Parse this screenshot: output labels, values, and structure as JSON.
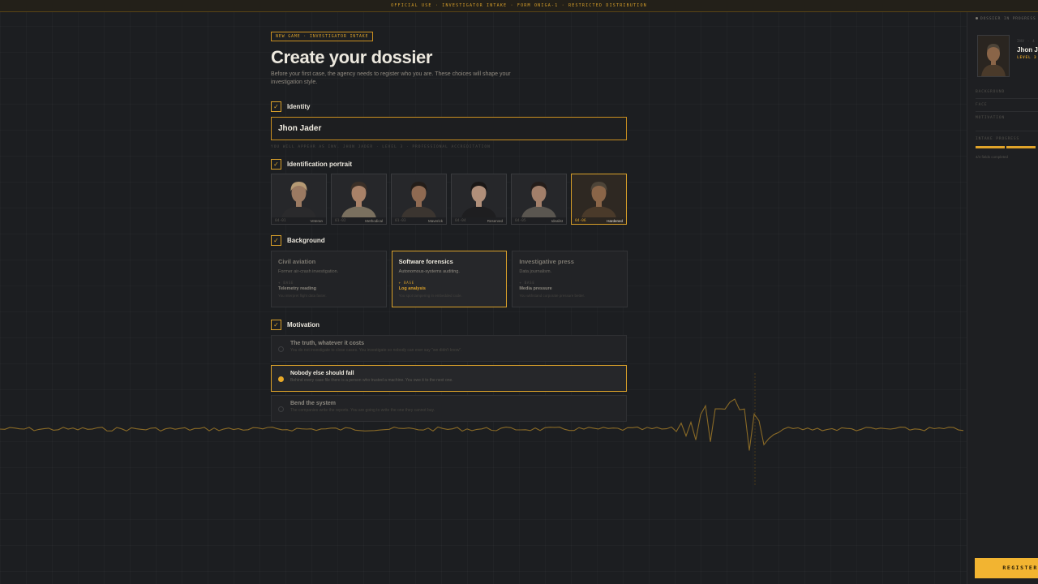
{
  "topbar": {
    "text": "OFFICIAL USE · INVESTIGATOR INTAKE · FORM ONIGA-1 · RESTRICTED DISTRIBUTION"
  },
  "header": {
    "tag": "NEW GAME · INVESTIGATOR INTAKE",
    "title": "Create your dossier",
    "subtitle": "Before your first case, the agency needs to register who you are. These choices will shape your investigation style."
  },
  "identity": {
    "title": "Identity",
    "check": "✓",
    "name_value": "Jhon Jader",
    "note": "YOU WILL APPEAR AS INV. JHON JADER · LEVEL 3 · PROFESSIONAL ACCREDITATION"
  },
  "portrait": {
    "title": "Identification portrait",
    "check": "✓",
    "items": [
      {
        "num": "04-01",
        "label": "Veteran",
        "skin": "#9b7a62",
        "hair": "#b59a74",
        "cloth": "#2a2a2c"
      },
      {
        "num": "01-02",
        "label": "Methodical",
        "skin": "#a88168",
        "hair": "#3a2f27",
        "cloth": "#7a705f"
      },
      {
        "num": "01-03",
        "label": "Maverick",
        "skin": "#8f6a52",
        "hair": "#231d19",
        "cloth": "#3b3530"
      },
      {
        "num": "04-04",
        "label": "Reserved",
        "skin": "#b08f7a",
        "hair": "#1a1716",
        "cloth": "#1e1e20"
      },
      {
        "num": "04-05",
        "label": "Idealist",
        "skin": "#a27f6a",
        "hair": "#241d1a",
        "cloth": "#5a5650"
      },
      {
        "num": "04-06",
        "label": "Hardened",
        "skin": "#8a6548",
        "hair": "#4d4438",
        "cloth": "#4a3a2a"
      }
    ]
  },
  "background": {
    "title": "Background",
    "check": "✓",
    "cards": [
      {
        "title": "Civil aviation",
        "sub": "Former air-crash investigation.",
        "bonus": "+ BASE",
        "skill": "Telemetry reading",
        "desc": "You interpret flight data faster."
      },
      {
        "title": "Software forensics",
        "sub": "Autonomous-systems auditing.",
        "bonus": "+ BASE",
        "skill": "Log analysis",
        "desc": "You spot tampering in embedded code."
      },
      {
        "title": "Investigative press",
        "sub": "Data journalism.",
        "bonus": "+ BASE",
        "skill": "Media pressure",
        "desc": "You withstand corporate pressure better."
      }
    ]
  },
  "motivation": {
    "title": "Motivation",
    "check": "✓",
    "options": [
      {
        "title": "The truth, whatever it costs",
        "desc": "You do not investigate to close cases. You investigate so nobody can ever say \"we didn't know\"."
      },
      {
        "title": "Nobody else should fall",
        "desc": "Behind every case file there is a person who trusted a machine. You owe it to the next one."
      },
      {
        "title": "Bend the system",
        "desc": "The companies write the reports. You are going to write the one they cannot buy."
      }
    ]
  },
  "sidebar": {
    "header": "DOSSIER IN PROGRESS",
    "code": "INV · 4",
    "name": "Jhon J",
    "level": "LEVEL 3",
    "field1": "BACKGROUND",
    "field2": "FACE",
    "field3": "MOTIVATION",
    "progress_label": "INTAKE PROGRESS",
    "count": "4/4 fields completed",
    "button": "REGISTER A"
  },
  "colors": {
    "accent": "#d9a02a",
    "button": "#f2b431",
    "background": "#1c1e21"
  }
}
